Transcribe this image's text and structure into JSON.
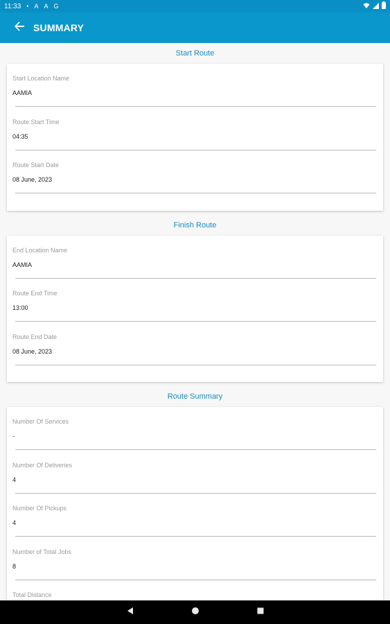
{
  "status_bar": {
    "time": "11:33",
    "indicators": [
      "•",
      "A",
      "A",
      "G"
    ],
    "icons": [
      "wifi-icon",
      "signal-icon",
      "battery-icon"
    ]
  },
  "app_bar": {
    "title": "SUMMARY",
    "back_icon": "arrow-back-icon"
  },
  "sections": {
    "start_route": {
      "title": "Start Route",
      "fields": [
        {
          "label": "Start Location Name",
          "value": "AAMIA"
        },
        {
          "label": "Route Start Time",
          "value": "04:35"
        },
        {
          "label": "Route Start Date",
          "value": "08 June, 2023"
        }
      ]
    },
    "finish_route": {
      "title": "Finish Route",
      "fields": [
        {
          "label": "End Location Name",
          "value": "AAMIA"
        },
        {
          "label": "Route End Time",
          "value": "13:00"
        },
        {
          "label": "Route End Date",
          "value": "08 June, 2023"
        }
      ]
    },
    "route_summary": {
      "title": "Route Summary",
      "fields": [
        {
          "label": "Number Of Services",
          "value": "-"
        },
        {
          "label": "Number Of Deliveries",
          "value": "4"
        },
        {
          "label": "Number Of Pickups",
          "value": "4"
        },
        {
          "label": "Number of Total Jobs",
          "value": "8"
        },
        {
          "label": "Total Distance",
          "value": ""
        }
      ]
    }
  },
  "nav_bar": {
    "icons": [
      "back-triangle-icon",
      "home-circle-icon",
      "recents-square-icon"
    ]
  },
  "colors": {
    "primary": "#0a97cb",
    "status_bar": "#0a8fc4",
    "section_title": "#178bc4"
  }
}
